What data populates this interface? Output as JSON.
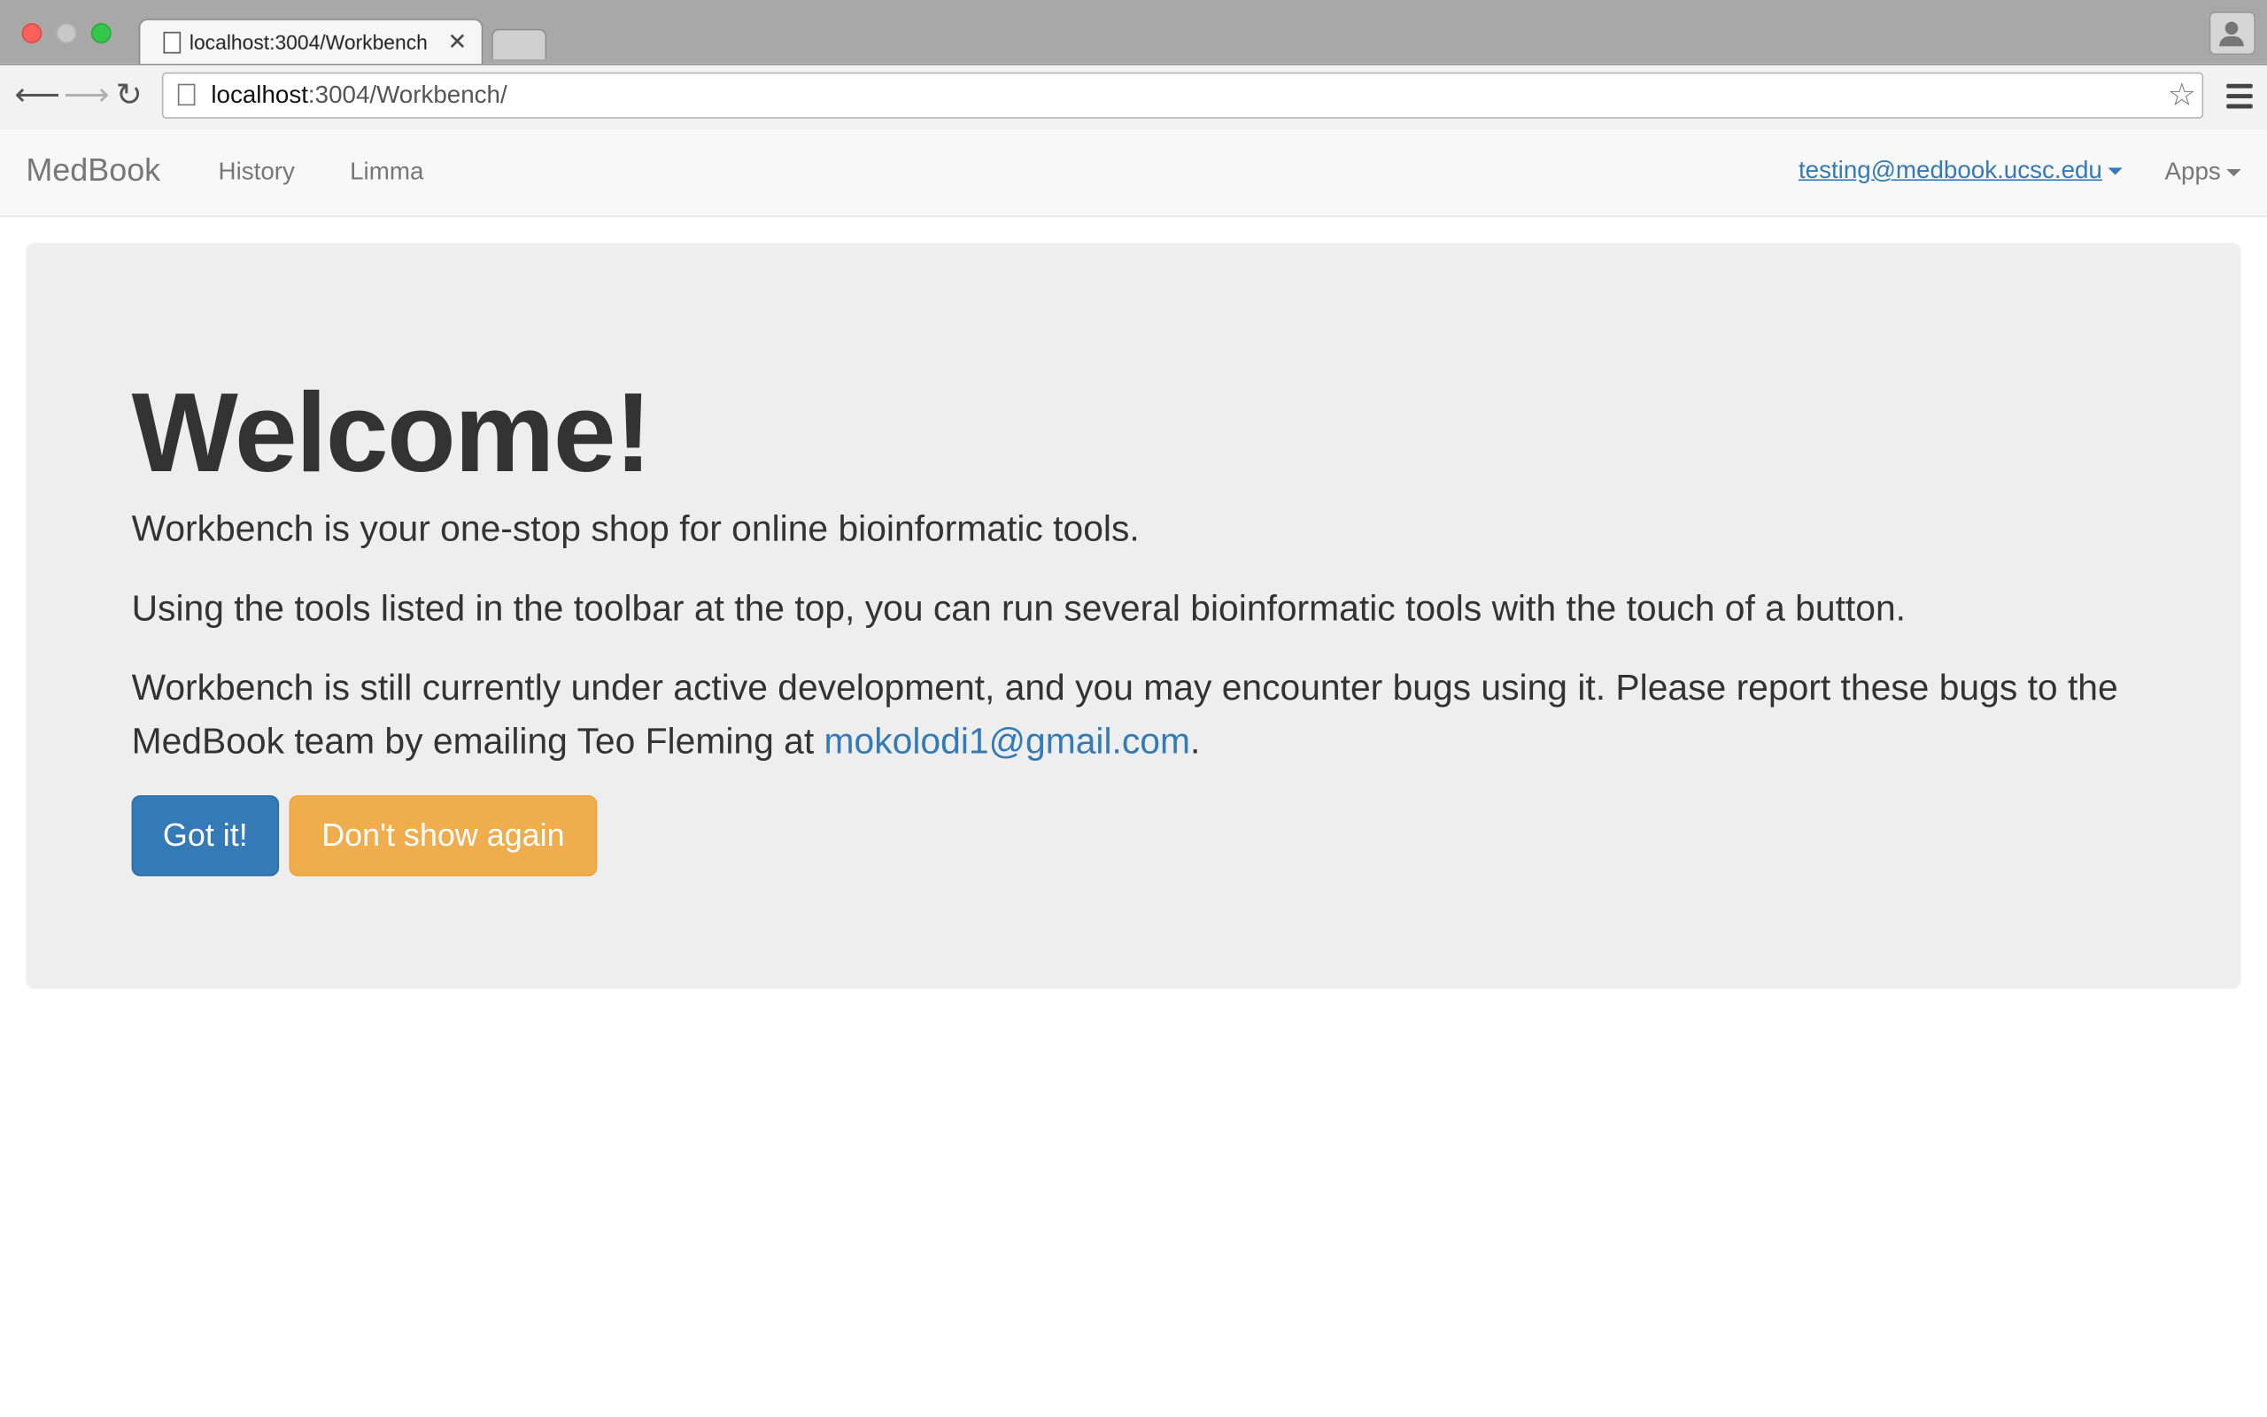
{
  "browser": {
    "tab_title": "localhost:3004/Workbench",
    "url_host": "localhost",
    "url_rest": ":3004/Workbench/"
  },
  "navbar": {
    "brand": "MedBook",
    "links": [
      "History",
      "Limma"
    ],
    "user": "testing@medbook.ucsc.edu",
    "apps": "Apps"
  },
  "jumbotron": {
    "heading": "Welcome!",
    "p1": "Workbench is your one-stop shop for online bioinformatic tools.",
    "p2": "Using the tools listed in the toolbar at the top, you can run several bioinformatic tools with the touch of a button.",
    "p3_before": "Workbench is still currently under active development, and you may encounter bugs using it. Please report these bugs to the MedBook team by emailing Teo Fleming at ",
    "p3_email": "mokolodi1@gmail.com",
    "p3_after": ".",
    "btn_got_it": "Got it!",
    "btn_dont_show": "Don't show again"
  },
  "colors": {
    "primary": "#337ab7",
    "warning": "#f0ad4e",
    "jumbotron_bg": "#eeeeee"
  }
}
